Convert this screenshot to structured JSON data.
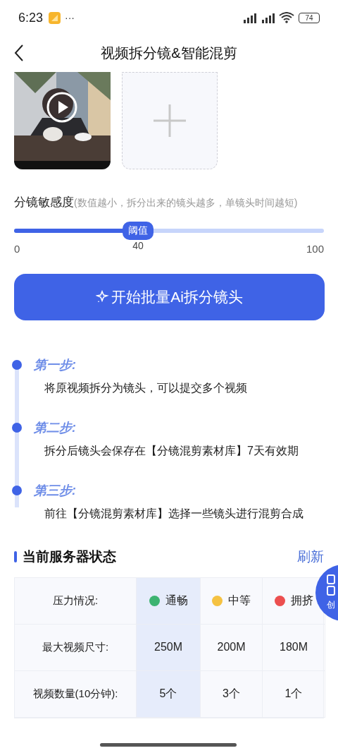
{
  "status_bar": {
    "time": "6:23",
    "more": "···",
    "battery": "74"
  },
  "header": {
    "title": "视频拆分镜&智能混剪"
  },
  "videos": [
    {
      "kind": "picture"
    },
    {
      "kind": "add"
    }
  ],
  "sensitivity": {
    "label": "分镜敏感度",
    "hint": "(数值越小，拆分出来的镜头越多，单镜头时间越短)",
    "thumb_label": "阈值",
    "value": "40",
    "min": "0",
    "max": "100",
    "level": 0.4
  },
  "start_button": {
    "label": "开始批量Ai拆分镜头"
  },
  "steps": [
    {
      "title": "第一步:",
      "text": "将原视频拆分为镜头，可以提交多个视频"
    },
    {
      "title": "第二步:",
      "text": "拆分后镜头会保存在【分镜混剪素材库】7天有效期"
    },
    {
      "title": "第三步:",
      "text": "前往【分镜混剪素材库】选择一些镜头进行混剪合成"
    }
  ],
  "server": {
    "title": "当前服务器状态",
    "refresh": "刷新",
    "row_labels": [
      "压力情况:",
      "最大视频尺寸:",
      "视频数量(10分钟):"
    ],
    "columns": [
      {
        "status": "通畅",
        "color": "#3cb371",
        "size": "250M",
        "count": "5个",
        "selected": true
      },
      {
        "status": "中等",
        "color": "#f5c242",
        "size": "200M",
        "count": "3个",
        "selected": false
      },
      {
        "status": "拥挤",
        "color": "#ec4f4f",
        "size": "180M",
        "count": "1个",
        "selected": false
      }
    ]
  },
  "floating_button": {
    "label": "创"
  }
}
